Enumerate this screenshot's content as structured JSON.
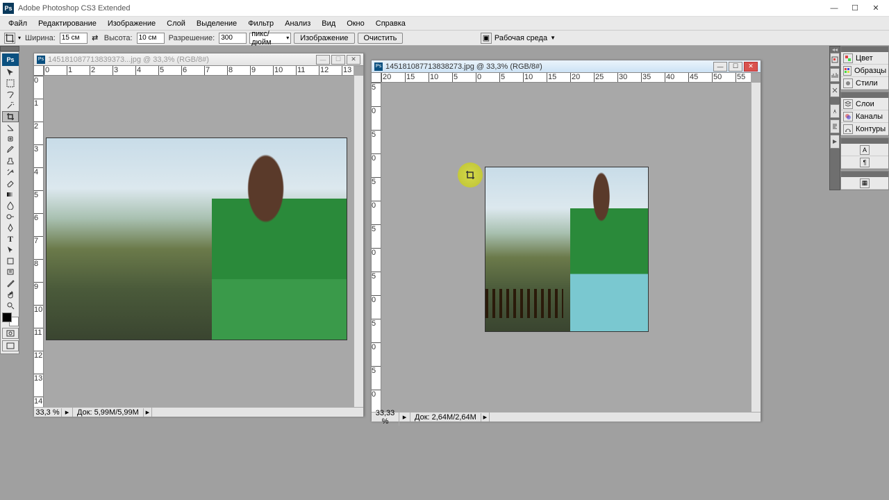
{
  "app": {
    "title": "Adobe Photoshop CS3 Extended"
  },
  "menu": [
    "Файл",
    "Редактирование",
    "Изображение",
    "Слой",
    "Выделение",
    "Фильтр",
    "Анализ",
    "Вид",
    "Окно",
    "Справка"
  ],
  "options": {
    "width_label": "Ширина:",
    "width_value": "15 см",
    "height_label": "Высота:",
    "height_value": "10 см",
    "resolution_label": "Разрешение:",
    "resolution_value": "300",
    "unit": "пикс/дюйм",
    "front_image_btn": "Изображение",
    "clear_btn": "Очистить",
    "workspace_label": "Рабочая среда"
  },
  "doc1": {
    "title": "145181087713839373...jpg @ 33,3% (RGB/8#)",
    "zoom": "33,3 %",
    "info": "Док: 5,99M/5,99M"
  },
  "doc2": {
    "title": "145181087713838273.jpg @ 33,3% (RGB/8#)",
    "zoom": "33,33 %",
    "info": "Док: 2,64M/2,64M"
  },
  "panels": {
    "group1": [
      "Цвет",
      "Образцы",
      "Стили"
    ],
    "group2": [
      "Слои",
      "Каналы",
      "Контуры"
    ]
  },
  "ruler_h": [
    "0",
    "1",
    "2",
    "3",
    "4",
    "5",
    "6",
    "7",
    "8",
    "9",
    "10",
    "11",
    "12",
    "13"
  ],
  "ruler_v": [
    "0",
    "1",
    "2",
    "3",
    "4",
    "5",
    "6",
    "7",
    "8",
    "9",
    "10",
    "11",
    "12",
    "13",
    "14"
  ],
  "ruler2_h": [
    "20",
    "15",
    "10",
    "5",
    "0",
    "5",
    "10",
    "15",
    "20",
    "25",
    "30",
    "35",
    "40",
    "45",
    "50",
    "55"
  ],
  "ruler2_v": [
    "5",
    "0",
    "5",
    "0",
    "5",
    "0",
    "5",
    "0",
    "5",
    "0",
    "5",
    "0",
    "5",
    "0"
  ]
}
